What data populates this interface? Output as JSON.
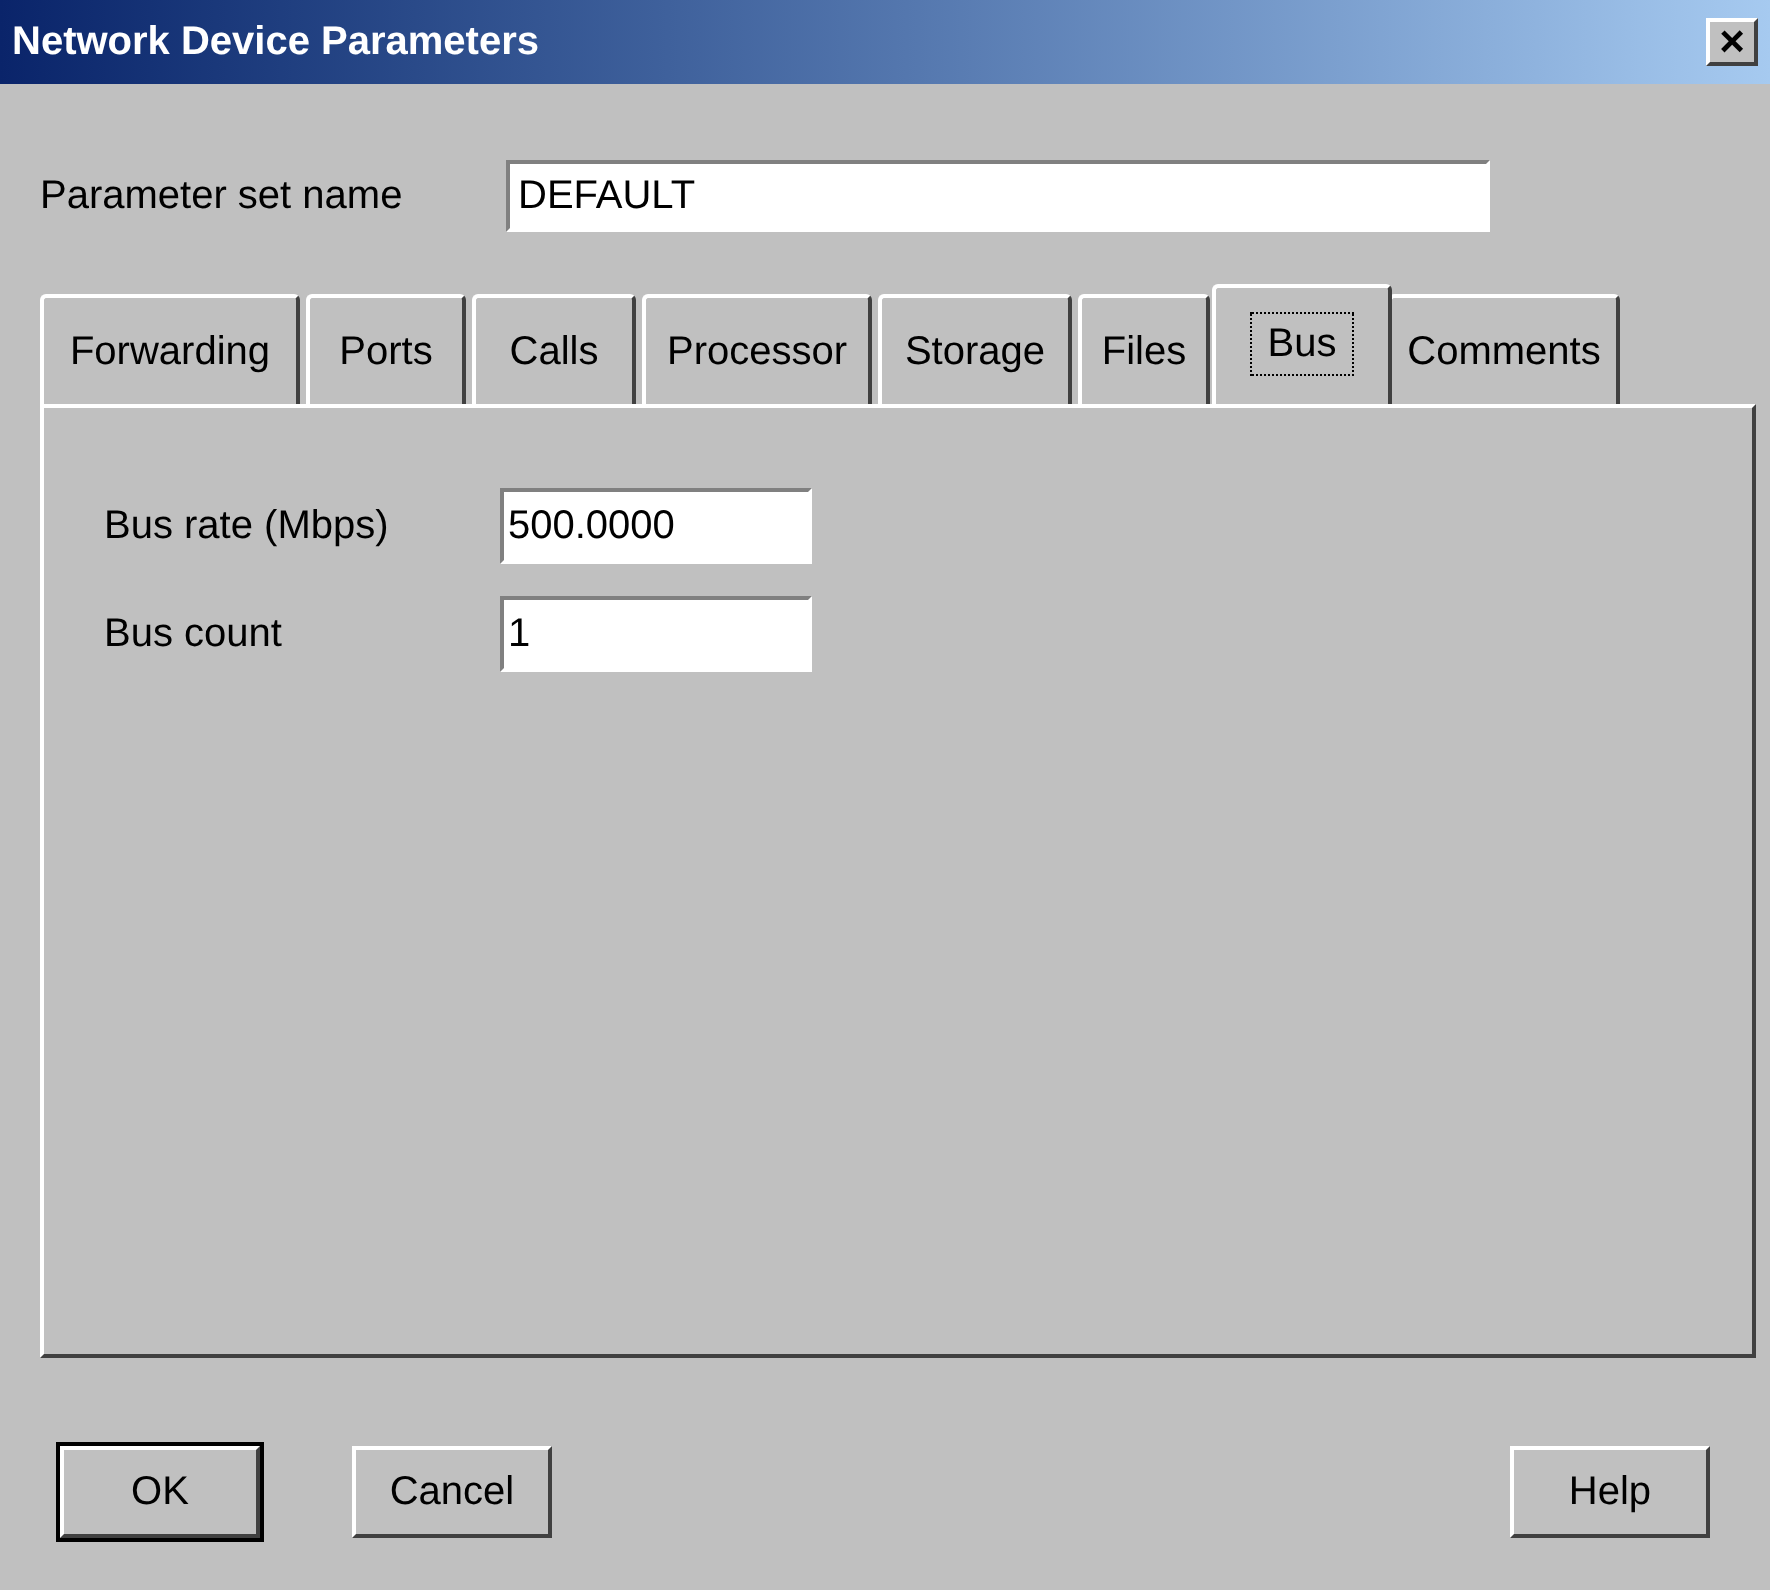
{
  "window": {
    "title": "Network Device Parameters",
    "close": "×"
  },
  "parameter_set": {
    "label": "Parameter set name",
    "value": "DEFAULT"
  },
  "tabs": [
    {
      "label": "Forwarding",
      "selected": false
    },
    {
      "label": "Ports",
      "selected": false
    },
    {
      "label": "Calls",
      "selected": false
    },
    {
      "label": "Processor",
      "selected": false
    },
    {
      "label": "Storage",
      "selected": false
    },
    {
      "label": "Files",
      "selected": false
    },
    {
      "label": "Bus",
      "selected": true
    },
    {
      "label": "Comments",
      "selected": false
    }
  ],
  "fields": [
    {
      "label": "Bus rate (Mbps)",
      "value": "500.0000"
    },
    {
      "label": "Bus count",
      "value": "1"
    }
  ],
  "buttons": [
    {
      "label": "OK",
      "default": true
    },
    {
      "label": "Cancel",
      "default": false
    },
    {
      "label": "Help",
      "default": false
    }
  ]
}
